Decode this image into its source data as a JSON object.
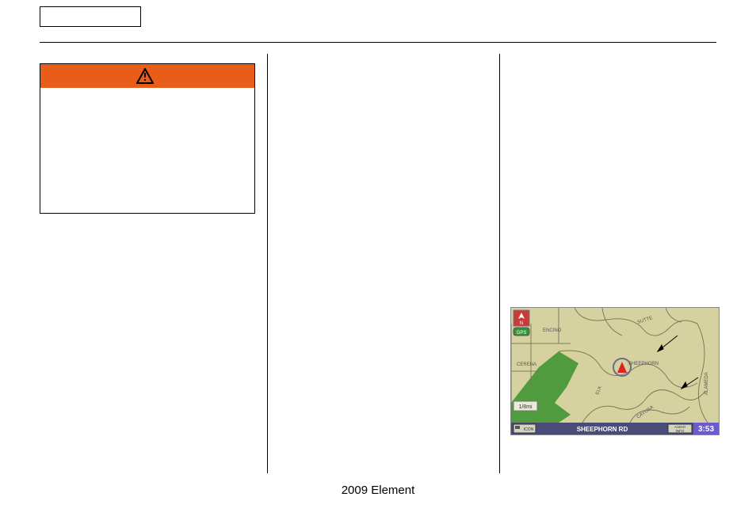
{
  "header": {
    "tab_label": ""
  },
  "warning": {
    "header_label": "",
    "body_text": ""
  },
  "nav_map": {
    "road_labels": {
      "encino": "ENCINO",
      "sutte": "SUTTE",
      "cerena": "CERENA",
      "sheephorn": "SHEEPHORN",
      "elk": "ELK",
      "alameda": "ALAMEDA",
      "cayusa": "CAYUSA"
    },
    "scale": "1/8mi",
    "compass": "N",
    "gps_label": "GPS",
    "icon_button": "ICON",
    "street_bar": "SHEEPHORN RD",
    "audio_button": "AUDIO INFO",
    "clock": "3:53"
  },
  "footer": {
    "model": "2009  Element"
  }
}
